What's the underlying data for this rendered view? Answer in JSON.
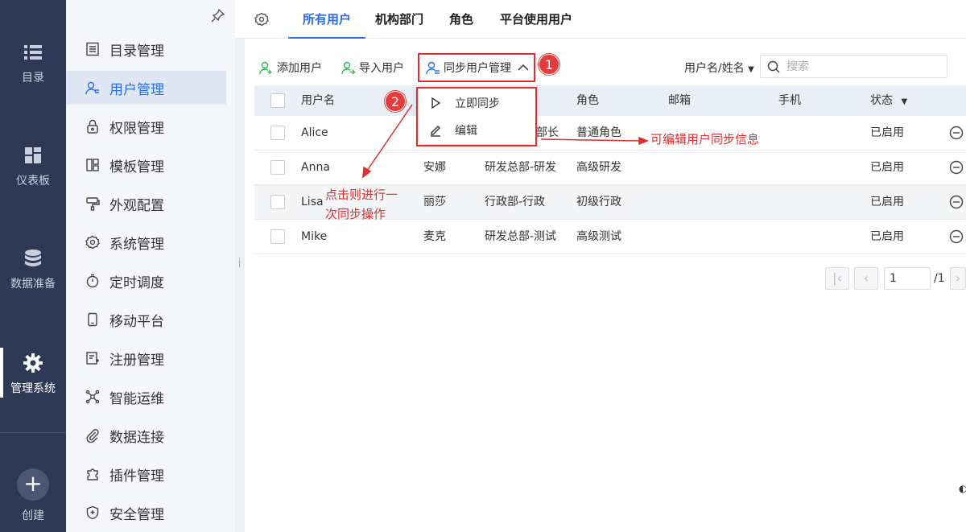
{
  "rail": {
    "items": [
      {
        "label": "目录",
        "icon": "list-icon"
      },
      {
        "label": "仪表板",
        "icon": "dashboard-icon"
      },
      {
        "label": "数据准备",
        "icon": "database-icon"
      },
      {
        "label": "管理系统",
        "icon": "gear-icon",
        "active": true
      },
      {
        "label": "创建",
        "icon": "plus-icon"
      }
    ]
  },
  "menu": {
    "items": [
      {
        "label": "目录管理"
      },
      {
        "label": "用户管理",
        "active": true
      },
      {
        "label": "权限管理"
      },
      {
        "label": "模板管理"
      },
      {
        "label": "外观配置"
      },
      {
        "label": "系统管理"
      },
      {
        "label": "定时调度"
      },
      {
        "label": "移动平台"
      },
      {
        "label": "注册管理"
      },
      {
        "label": "智能运维"
      },
      {
        "label": "数据连接"
      },
      {
        "label": "插件管理"
      },
      {
        "label": "安全管理"
      }
    ]
  },
  "tabs": [
    {
      "label": "所有用户",
      "active": true
    },
    {
      "label": "机构部门"
    },
    {
      "label": "角色"
    },
    {
      "label": "平台使用用户"
    }
  ],
  "toolbar": {
    "add_user": "添加用户",
    "import_user": "导入用户",
    "sync_manage": "同步用户管理",
    "search_type": "用户名/姓名",
    "search_placeholder": "搜索"
  },
  "table": {
    "headers": {
      "username": "用户名",
      "role": "角色",
      "email": "邮箱",
      "phone": "手机",
      "status": "状态"
    },
    "rows": [
      {
        "username": "Alice",
        "name": "",
        "dept": "部长",
        "role": "普通角色",
        "email": "",
        "phone": "",
        "status": "已启用"
      },
      {
        "username": "Anna",
        "name": "安娜",
        "dept": "研发总部-研发",
        "role": "高级研发",
        "email": "",
        "phone": "",
        "status": "已启用"
      },
      {
        "username": "Lisa",
        "name": "丽莎",
        "dept": "行政部-行政",
        "role": "初级行政",
        "email": "",
        "phone": "",
        "status": "已启用"
      },
      {
        "username": "Mike",
        "name": "麦克",
        "dept": "研发总部-测试",
        "role": "高级测试",
        "email": "",
        "phone": "",
        "status": "已启用"
      }
    ]
  },
  "pager": {
    "current": "1",
    "total": "/1"
  },
  "dropdown": {
    "items": [
      {
        "label": "立即同步",
        "icon": "play-icon"
      },
      {
        "label": "编辑",
        "icon": "edit-icon"
      }
    ]
  },
  "annotations": {
    "badge1": "1",
    "badge2": "2",
    "note_edit": "可编辑用户同步信息",
    "note_sync_line1": "点击则进行一",
    "note_sync_line2": "次同步操作",
    "color": "#e02d2d"
  },
  "colors": {
    "accent": "#2b6de5",
    "rail_bg": "#2e3a55",
    "green_icon": "#2db84d"
  }
}
